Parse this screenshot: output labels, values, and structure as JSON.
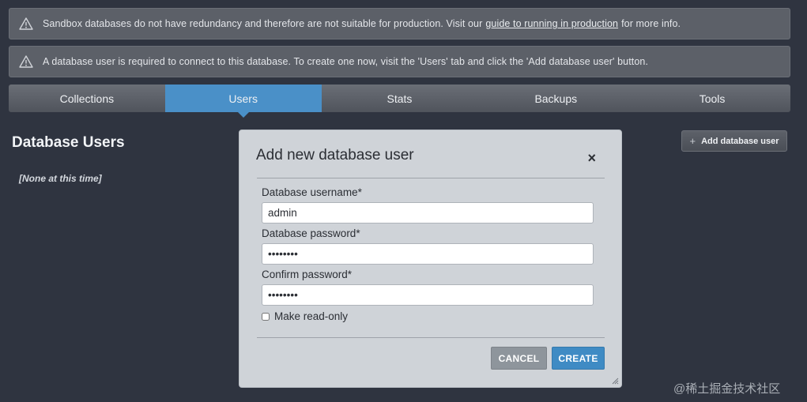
{
  "banners": [
    {
      "icon": "warning-triangle-icon",
      "text_before": "Sandbox databases do not have redundancy and therefore are not suitable for production. Visit our",
      "link_text": "guide to running in production",
      "text_after": "for more info."
    },
    {
      "icon": "warning-triangle-icon",
      "text": "A database user is required to connect to this database. To create one now, visit the 'Users' tab and click the 'Add database user' button."
    }
  ],
  "tabs": [
    {
      "label": "Collections",
      "active": false
    },
    {
      "label": "Users",
      "active": true
    },
    {
      "label": "Stats",
      "active": false
    },
    {
      "label": "Backups",
      "active": false
    },
    {
      "label": "Tools",
      "active": false
    }
  ],
  "page": {
    "title": "Database Users",
    "empty_note": "[None at this time]",
    "add_button_label": "Add database user"
  },
  "modal": {
    "title": "Add new database user",
    "close_symbol": "×",
    "username_label": "Database username*",
    "username_value": "admin",
    "password_label": "Database password*",
    "password_value": "••••••••",
    "confirm_label": "Confirm password*",
    "confirm_value": "••••••••",
    "readonly_label": "Make read-only",
    "readonly_checked": false,
    "cancel_label": "CANCEL",
    "create_label": "CREATE"
  },
  "watermark": "@稀土掘金技术社区",
  "colors": {
    "background": "#2f3440",
    "accent": "#4a90c8",
    "modal_bg": "#cfd3d8",
    "create_button": "#3f8bc4",
    "cancel_button": "#8e959c"
  }
}
